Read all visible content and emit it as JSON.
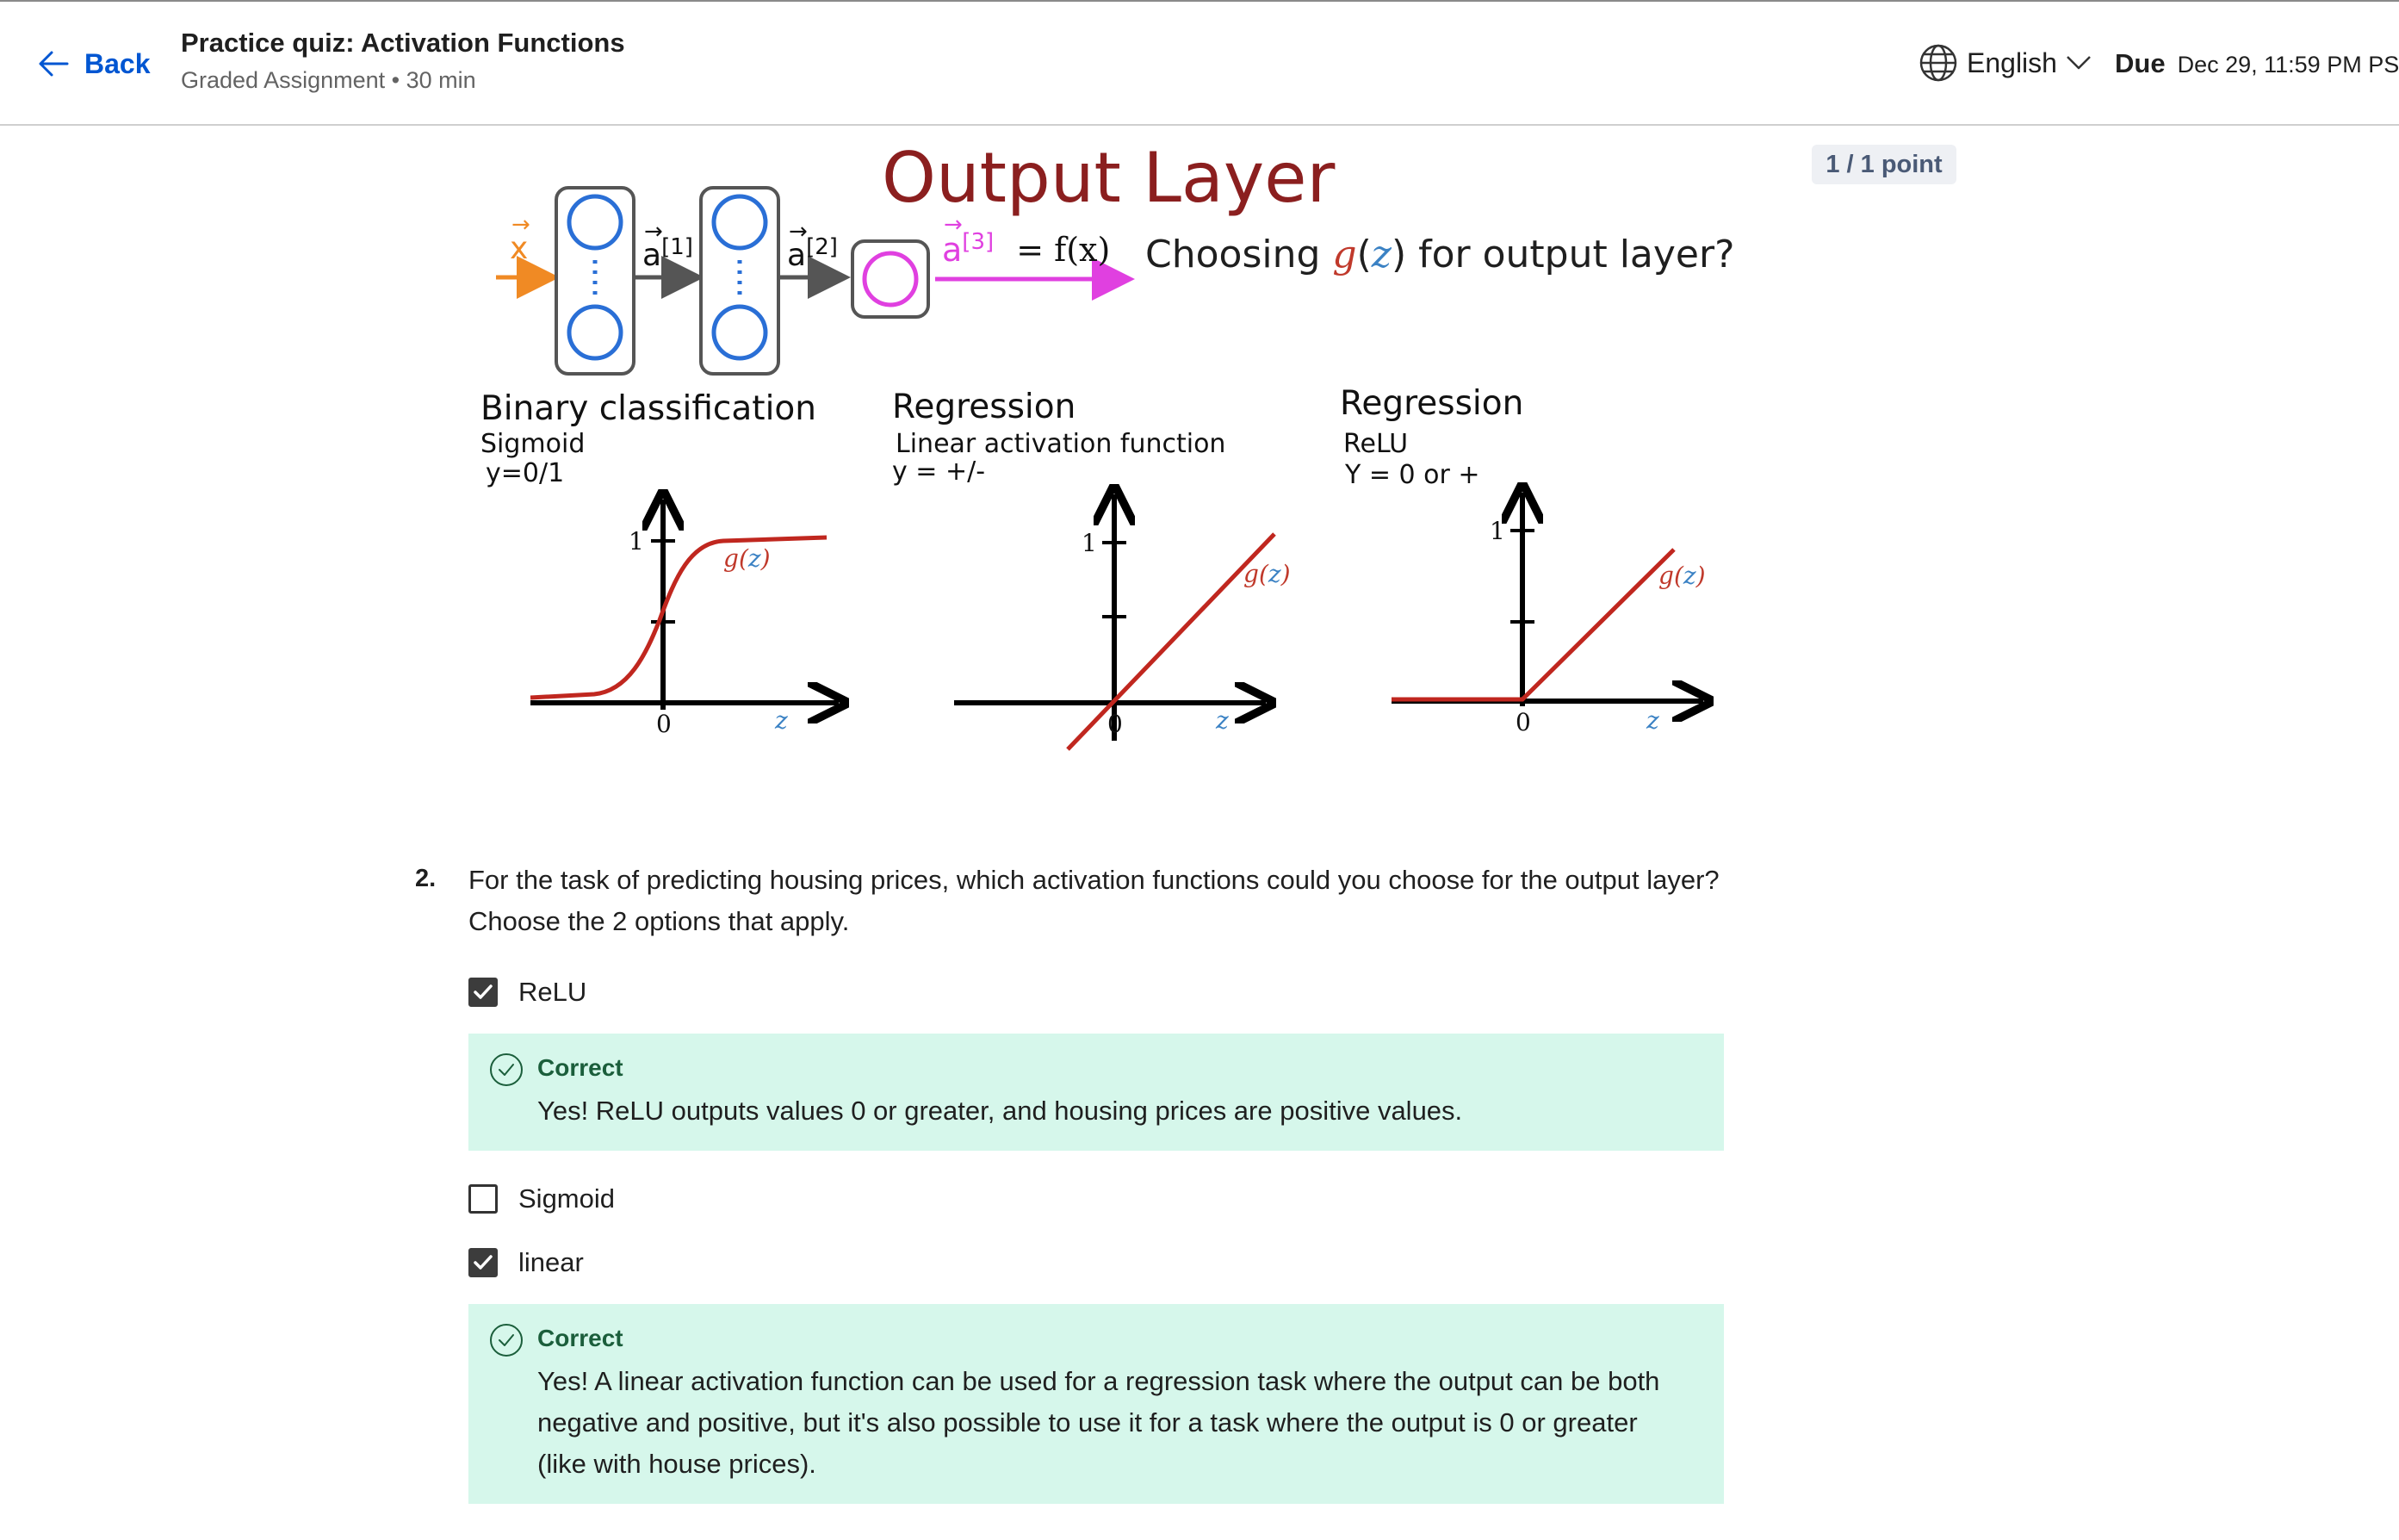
{
  "header": {
    "back_label": "Back",
    "title": "Practice quiz: Activation Functions",
    "subtitle": "Graded Assignment • 30 min",
    "language": "English",
    "due_label": "Due",
    "due_date": "Dec 29, 11:59 PM PST"
  },
  "score": "1 / 1 point",
  "figure": {
    "title": "Output Layer",
    "question_prefix": "Choosing ",
    "question_g": "g",
    "question_z": "z",
    "question_suffix": " for output layer?",
    "x_symbol": "x",
    "a1": "a",
    "a1_sup": "[1]",
    "a2": "a",
    "a2_sup": "[2]",
    "a3": "a",
    "a3_sup": "[3]",
    "fx": "= f(x)",
    "panels": [
      {
        "heading": "Binary classification",
        "sub1": "Sigmoid",
        "sub2": "y=0/1"
      },
      {
        "heading": "Regression",
        "sub1": "Linear activation function",
        "sub2": "y = +/-"
      },
      {
        "heading": "Regression",
        "sub1": "ReLU",
        "sub2": "Y = 0 or +"
      }
    ],
    "g_label": "g",
    "z_label": "z",
    "tick_one": "1",
    "tick_zero": "0"
  },
  "question": {
    "number": "2.",
    "text": "For the task of predicting housing prices, which activation functions could you choose for the output layer? Choose the 2 options that apply."
  },
  "options": [
    {
      "label": "ReLU",
      "checked": true
    },
    {
      "label": "Sigmoid",
      "checked": false
    },
    {
      "label": "linear",
      "checked": true
    }
  ],
  "feedback": [
    {
      "status": "Correct",
      "text": "Yes! ReLU outputs values 0 or greater, and housing prices are positive values."
    },
    {
      "status": "Correct",
      "text": "Yes! A linear activation function can be used for a regression task where the output can be both negative and positive, but it's also possible to use it for a task where the output is 0 or greater (like with house prices)."
    }
  ]
}
